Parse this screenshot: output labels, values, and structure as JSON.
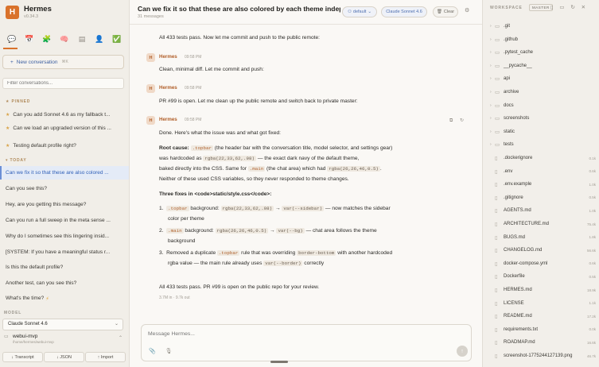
{
  "brand": {
    "name": "Hermes",
    "version": "v0.34.3",
    "logo_letter": "H"
  },
  "sidebar": {
    "tool_icons": [
      "chat-icon",
      "calendar-icon",
      "brain-icon",
      "memory-icon",
      "book-icon",
      "person-icon",
      "check-icon"
    ],
    "new_conversation": "New conversation",
    "new_conversation_shortcut": "⌘K",
    "search_placeholder": "Filter conversations...",
    "pinned_label": "PINNED",
    "today_label": "TODAY",
    "pinned": [
      "Can you add Sonnet 4.6 as my fallback t...",
      "Can we load an upgraded version of this ...",
      "Testing default profile right?"
    ],
    "today": [
      "Can we fix it so that these are also colored ...",
      "Can you see this?",
      "Hey, are you getting this message?",
      "Can you run a full sweep in the meta sense ...",
      "Why do I sometimes see this lingering insid...",
      "[SYSTEM: If you have a meaningful status r...",
      "Is this the default profile?",
      "Another test, can you see this?",
      "What's the time?"
    ],
    "model_label": "MODEL",
    "model_value": "Claude Sonnet 4.6",
    "workspace_name": "webui-mvp",
    "workspace_path": "/home/hermes/webui-mvp",
    "buttons": [
      "↓ Transcript",
      "↓ JSON",
      "↑ Import"
    ]
  },
  "topbar": {
    "title": "Can we fix it so that these are also colored by each theme indep",
    "subtitle": "31 messages",
    "profile_pill": "default",
    "model_pill": "Claude Sonnet 4.6",
    "clear_label": "Clear"
  },
  "chat": {
    "line1": "All 433 tests pass. Now let me commit and push to the public remote:",
    "msgs": [
      {
        "author": "Hermes",
        "time": "09:58 PM",
        "text": "Clean, minimal diff. Let me commit and push:"
      },
      {
        "author": "Hermes",
        "time": "09:58 PM",
        "text": "PR #99 is open. Let me clean up the public remote and switch back to private master:"
      },
      {
        "author": "Hermes",
        "time": "09:58 PM",
        "text": "Done. Here's what the issue was and what got fixed:"
      }
    ],
    "root_cause_label": "Root cause:",
    "root_code_topbar": ".topbar",
    "root_text1": " (the header bar with the conversation title, model selector, and settings gear)",
    "root_text2a": "was hardcoded as ",
    "root_code_rgba1": "rgba(22,33,62,.98)",
    "root_text2b": " — the exact dark navy of the default theme,",
    "root_text3a": "baked directly into the CSS. Same for ",
    "root_code_main": ".main",
    "root_text3b": " (the chat area) which had ",
    "root_code_rgba2": "rgba(26,26,46,0.5)",
    "root_text3c": ".",
    "root_text4": "Neither of these used CSS variables, so they never responded to theme changes.",
    "fixes_heading": "Three fixes in <code>static/style.css</code>:",
    "fix1_code": ".topbar",
    "fix1_a": " background: ",
    "fix1_rgba": "rgba(22,33,62,.98)",
    "fix1_var": "var(--sidebar)",
    "fix1_b": " — now matches the sidebar",
    "fix1_c": "color per theme",
    "fix2_code": ".main",
    "fix2_a": " background: ",
    "fix2_rgba": "rgba(26,26,46,0.5)",
    "fix2_var": "var(--bg)",
    "fix2_b": " — chat area follows the theme",
    "fix2_c": "background",
    "fix3_a": "Removed a duplicate ",
    "fix3_code": ".topbar",
    "fix3_b": " rule that was overriding ",
    "fix3_border": "border-bottom",
    "fix3_c": " with another hardcoded",
    "fix3_d": "rgba value — the main rule already uses ",
    "fix3_var": "var(--border)",
    "fix3_e": " correctly",
    "final_line": "All 433 tests pass. PR #99 is open on the public repo for your review.",
    "final_meta": "3.7M in · 9.7k out",
    "composer_placeholder": "Message Hermes..."
  },
  "workspace": {
    "title": "WORKSPACE",
    "badge": "MASTER",
    "tree": [
      {
        "name": ".git",
        "type": "dir",
        "size": ""
      },
      {
        "name": ".github",
        "type": "dir",
        "size": ""
      },
      {
        "name": ".pytest_cache",
        "type": "dir",
        "size": ""
      },
      {
        "name": "__pycache__",
        "type": "dir",
        "size": ""
      },
      {
        "name": "api",
        "type": "dir",
        "size": ""
      },
      {
        "name": "archive",
        "type": "dir",
        "size": ""
      },
      {
        "name": "docs",
        "type": "dir",
        "size": ""
      },
      {
        "name": "screenshots",
        "type": "dir",
        "size": ""
      },
      {
        "name": "static",
        "type": "dir",
        "size": ""
      },
      {
        "name": "tests",
        "type": "dir",
        "size": ""
      },
      {
        "name": ".dockerignore",
        "type": "file",
        "size": "0.1k"
      },
      {
        "name": ".env",
        "type": "file",
        "size": "0.6k"
      },
      {
        "name": ".env.example",
        "type": "file",
        "size": "1.0k"
      },
      {
        "name": ".gitignore",
        "type": "file",
        "size": "0.5k"
      },
      {
        "name": "AGENTS.md",
        "type": "file",
        "size": "1.0k"
      },
      {
        "name": "ARCHITECTURE.md",
        "type": "file",
        "size": "75.4k"
      },
      {
        "name": "BUGS.md",
        "type": "file",
        "size": "1.8k"
      },
      {
        "name": "CHANGELOG.md",
        "type": "file",
        "size": "56.6k"
      },
      {
        "name": "docker-compose.yml",
        "type": "file",
        "size": "0.6k"
      },
      {
        "name": "Dockerfile",
        "type": "file",
        "size": "0.5k"
      },
      {
        "name": "HERMES.md",
        "type": "file",
        "size": "18.9k"
      },
      {
        "name": "LICENSE",
        "type": "file",
        "size": "1.1k"
      },
      {
        "name": "README.md",
        "type": "file",
        "size": "17.2k"
      },
      {
        "name": "requirements.txt",
        "type": "file",
        "size": "0.0k"
      },
      {
        "name": "ROADMAP.md",
        "type": "file",
        "size": "16.6k"
      },
      {
        "name": "screenshot-1775244127139.png",
        "type": "file",
        "size": "46.7k"
      }
    ]
  },
  "colors": {
    "accent": "#d9722b",
    "link": "#3b5ea0",
    "active_conv_bg": "#e4ebf7"
  }
}
